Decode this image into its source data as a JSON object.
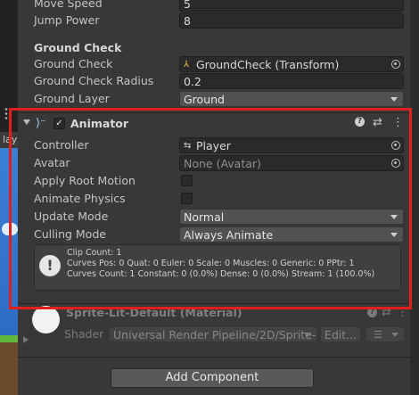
{
  "player_settings": {
    "move_speed": {
      "label": "Move Speed",
      "value": "5"
    },
    "jump_power": {
      "label": "Jump Power",
      "value": "8"
    }
  },
  "ground_check_section": {
    "header": "Ground Check",
    "ground_check": {
      "label": "Ground Check",
      "value": "GroundCheck (Transform)"
    },
    "radius": {
      "label": "Ground Check Radius",
      "value": "0.2"
    },
    "layer": {
      "label": "Ground Layer",
      "value": "Ground"
    }
  },
  "animator": {
    "title": "Animator",
    "enabled": true,
    "controller": {
      "label": "Controller",
      "value": "Player"
    },
    "avatar": {
      "label": "Avatar",
      "value": "None (Avatar)"
    },
    "apply_root_motion": {
      "label": "Apply Root Motion",
      "checked": false
    },
    "animate_physics": {
      "label": "Animate Physics",
      "checked": false
    },
    "update_mode": {
      "label": "Update Mode",
      "value": "Normal"
    },
    "culling_mode": {
      "label": "Culling Mode",
      "value": "Always Animate"
    },
    "info": {
      "line1": "Clip Count: 1",
      "line2": "Curves Pos: 0 Quat: 0 Euler: 0 Scale: 0 Muscles: 0 Generic: 0 PPtr: 1",
      "line3": "Curves Count: 1 Constant: 0 (0.0%) Dense: 0 (0.0%) Stream: 1 (100.0%)"
    }
  },
  "material": {
    "name": "Sprite-Lit-Default (Material)",
    "shader_label": "Shader",
    "shader_value": "Universal Render Pipeline/2D/Sprite-L",
    "edit_label": "Edit..."
  },
  "add_component_label": "Add Component",
  "left_tab_label": "lay",
  "colors": {
    "highlight_frame": "#e0201c",
    "panel_bg": "#383838"
  }
}
